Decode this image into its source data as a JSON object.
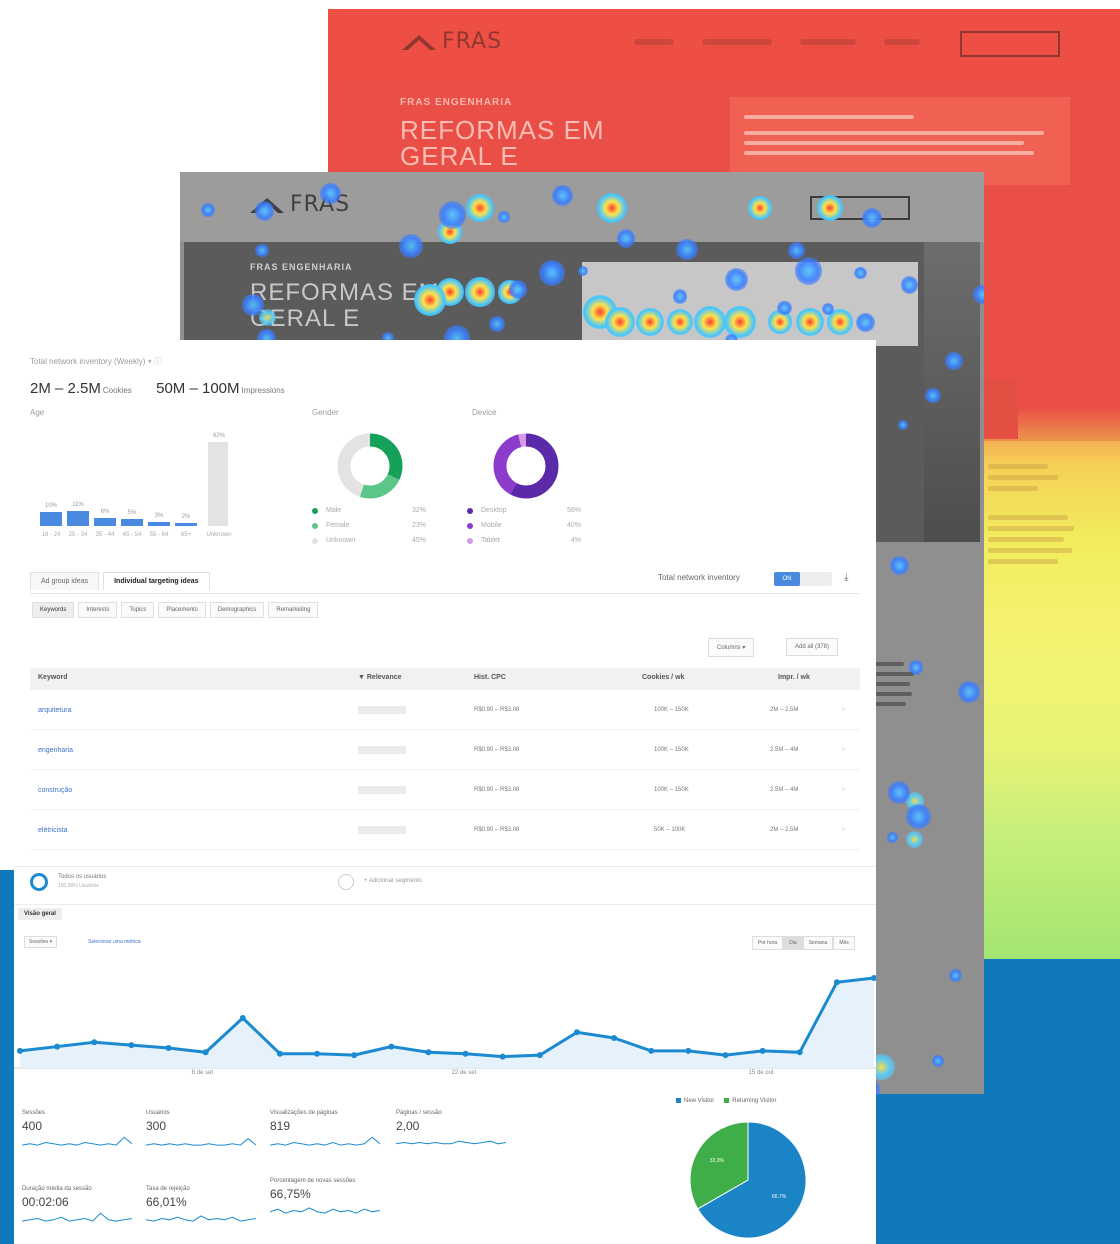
{
  "heat_site": {
    "logo_text": "FRAS",
    "hero_small": "FRAS ENGENHARIA",
    "hero_big": "REFORMAS EM GERAL E"
  },
  "map_site": {
    "logo_text": "FRAS",
    "hero_small": "FRAS ENGENHARIA",
    "hero_big": "REFORMAS EM GERAL E"
  },
  "planner": {
    "title": "Total network inventory (Weekly)",
    "cookies": {
      "value": "2M – 2.5M",
      "unit": "Cookies"
    },
    "impressions": {
      "value": "50M – 100M",
      "unit": "Impressions"
    },
    "age": {
      "label": "Age",
      "bars": [
        {
          "cat": "18 - 24",
          "value": 10,
          "label": "10%"
        },
        {
          "cat": "25 - 34",
          "value": 11,
          "label": "11%"
        },
        {
          "cat": "35 - 44",
          "value": 6,
          "label": "6%"
        },
        {
          "cat": "45 - 54",
          "value": 5,
          "label": "5%"
        },
        {
          "cat": "55 - 64",
          "value": 3,
          "label": "3%"
        },
        {
          "cat": "65+",
          "value": 2,
          "label": "2%"
        },
        {
          "cat": "Unknown",
          "value": 62,
          "label": "62%"
        }
      ]
    },
    "gender": {
      "label": "Gender",
      "items": [
        {
          "name": "Male",
          "value": 32,
          "label": "32%",
          "color": "#16a15a"
        },
        {
          "name": "Female",
          "value": 23,
          "label": "23%",
          "color": "#5cc58a"
        },
        {
          "name": "Unknown",
          "value": 45,
          "label": "45%",
          "color": "#e3e3e3"
        }
      ]
    },
    "device": {
      "label": "Device",
      "items": [
        {
          "name": "Desktop",
          "value": 58,
          "label": "56%",
          "color": "#5b2aa8"
        },
        {
          "name": "Mobile",
          "value": 38,
          "label": "40%",
          "color": "#8b3ccc"
        },
        {
          "name": "Tablet",
          "value": 4,
          "label": "4%",
          "color": "#d49ae6"
        }
      ]
    },
    "tabs": [
      "Ad group ideas",
      "Individual targeting ideas"
    ],
    "subtabs": [
      "Keywords",
      "Interests",
      "Topics",
      "Placements",
      "Demographics",
      "Remarketing"
    ],
    "inventory_label": "Total network inventory",
    "toggle_on": "ON",
    "columns_btn": "Columns ▾",
    "add_btn": "Add all (378)",
    "headers": {
      "keyword": "Keyword",
      "relevance": "▼ Relevance",
      "cpc": "Hist. CPC",
      "cookies": "Cookies / wk",
      "impr": "Impr. / wk"
    },
    "rows": [
      {
        "keyword": "arquitetura",
        "cpc": "R$0.90 – R$3.08",
        "cookies": "100K – 150K",
        "impr": "2M – 2.5M"
      },
      {
        "keyword": "engenharia",
        "cpc": "R$0.90 – R$3.08",
        "cookies": "100K – 150K",
        "impr": "2.5M – 4M"
      },
      {
        "keyword": "construção",
        "cpc": "R$0.90 – R$3.08",
        "cookies": "100K – 150K",
        "impr": "2.5M – 4M"
      },
      {
        "keyword": "elétricista",
        "cpc": "R$0.90 – R$3.08",
        "cookies": "50K – 100K",
        "impr": "2M – 2.5M"
      }
    ]
  },
  "analytics": {
    "segment_all": "Todos os usuários",
    "segment_all_sub": "100,00% Usuários",
    "segment_add": "+ Adicionar segmento",
    "overview_tab": "Visão geral",
    "metric_select": "Sessões",
    "compare_link": "Selecionar uma métrica",
    "period_buttons": [
      "Por hora",
      "Dia",
      "Semana",
      "Mês"
    ],
    "x_ticks": [
      "8 de set",
      "22 de set",
      "15 de out"
    ],
    "line_series": [
      12,
      15,
      18,
      16,
      14,
      11,
      35,
      10,
      10,
      9,
      15,
      11,
      10,
      8,
      9,
      25,
      21,
      12,
      12,
      9,
      12,
      11,
      60,
      63
    ],
    "metrics": [
      {
        "label": "Sessões",
        "value": "400"
      },
      {
        "label": "Usuários",
        "value": "300"
      },
      {
        "label": "Visualizações de páginas",
        "value": "819"
      },
      {
        "label": "Páginas / sessão",
        "value": "2,00"
      },
      {
        "label": "Duração média da sessão",
        "value": "00:02:06"
      },
      {
        "label": "Taxa de rejeição",
        "value": "66,01%"
      },
      {
        "label": "Porcentagem de novas sessões",
        "value": "66,75%"
      }
    ],
    "pie": {
      "legend": [
        {
          "name": "New Visitor",
          "color": "#1a84c7"
        },
        {
          "name": "Returning Visitor",
          "color": "#3fae49"
        }
      ],
      "slices": [
        {
          "name": "New Visitor",
          "value": 66.7,
          "label": "66.7%",
          "color": "#1a84c7"
        },
        {
          "name": "Returning Visitor",
          "value": 33.3,
          "label": "33.3%",
          "color": "#3fae49"
        }
      ]
    }
  }
}
